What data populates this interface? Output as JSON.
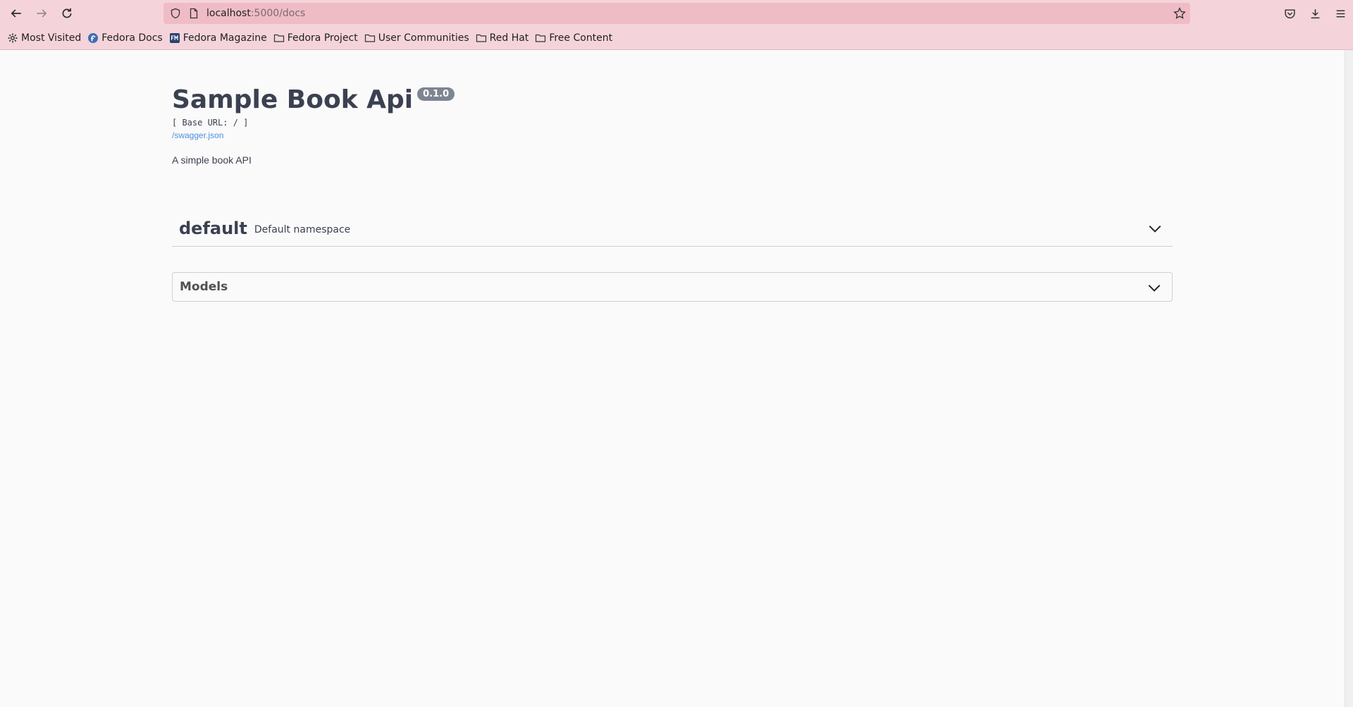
{
  "browser": {
    "url_host": "localhost",
    "url_path": ":5000/docs",
    "bookmarks": [
      {
        "label": "Most Visited",
        "icon": "gear-icon"
      },
      {
        "label": "Fedora Docs",
        "icon": "fedora-icon"
      },
      {
        "label": "Fedora Magazine",
        "icon": "fedora-magazine-icon"
      },
      {
        "label": "Fedora Project",
        "icon": "folder-icon"
      },
      {
        "label": "User Communities",
        "icon": "folder-icon"
      },
      {
        "label": "Red Hat",
        "icon": "folder-icon"
      },
      {
        "label": "Free Content",
        "icon": "folder-icon"
      }
    ]
  },
  "api": {
    "title": "Sample Book Api",
    "version": "0.1.0",
    "base_url": "[ Base URL: / ]",
    "spec_link": "/swagger.json",
    "description": "A simple book API"
  },
  "namespace": {
    "name": "default",
    "description": "Default namespace"
  },
  "models": {
    "title": "Models"
  },
  "colors": {
    "chrome": "#f4d4da",
    "urlbar": "#efbcc5",
    "text": "#3b4151",
    "link": "#4990e2",
    "version_badge": "#7d8492"
  }
}
